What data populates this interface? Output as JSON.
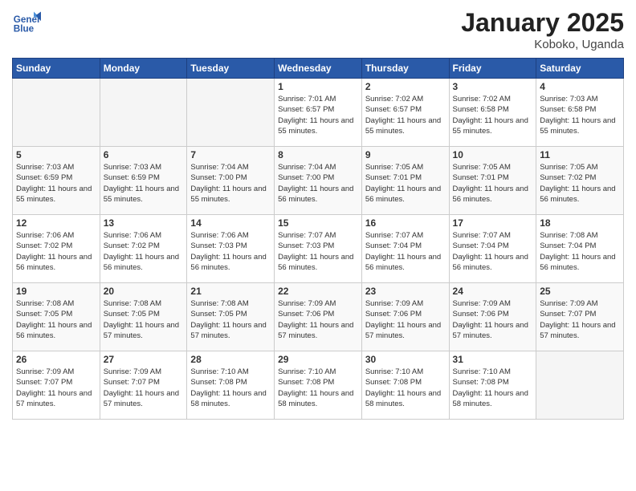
{
  "header": {
    "logo_line1": "General",
    "logo_line2": "Blue",
    "month_title": "January 2025",
    "subtitle": "Koboko, Uganda"
  },
  "days_of_week": [
    "Sunday",
    "Monday",
    "Tuesday",
    "Wednesday",
    "Thursday",
    "Friday",
    "Saturday"
  ],
  "weeks": [
    [
      {
        "day": "",
        "empty": true
      },
      {
        "day": "",
        "empty": true
      },
      {
        "day": "",
        "empty": true
      },
      {
        "day": "1",
        "sunrise": "7:01 AM",
        "sunset": "6:57 PM",
        "daylight": "11 hours and 55 minutes."
      },
      {
        "day": "2",
        "sunrise": "7:02 AM",
        "sunset": "6:57 PM",
        "daylight": "11 hours and 55 minutes."
      },
      {
        "day": "3",
        "sunrise": "7:02 AM",
        "sunset": "6:58 PM",
        "daylight": "11 hours and 55 minutes."
      },
      {
        "day": "4",
        "sunrise": "7:03 AM",
        "sunset": "6:58 PM",
        "daylight": "11 hours and 55 minutes."
      }
    ],
    [
      {
        "day": "5",
        "sunrise": "7:03 AM",
        "sunset": "6:59 PM",
        "daylight": "11 hours and 55 minutes."
      },
      {
        "day": "6",
        "sunrise": "7:03 AM",
        "sunset": "6:59 PM",
        "daylight": "11 hours and 55 minutes."
      },
      {
        "day": "7",
        "sunrise": "7:04 AM",
        "sunset": "7:00 PM",
        "daylight": "11 hours and 55 minutes."
      },
      {
        "day": "8",
        "sunrise": "7:04 AM",
        "sunset": "7:00 PM",
        "daylight": "11 hours and 56 minutes."
      },
      {
        "day": "9",
        "sunrise": "7:05 AM",
        "sunset": "7:01 PM",
        "daylight": "11 hours and 56 minutes."
      },
      {
        "day": "10",
        "sunrise": "7:05 AM",
        "sunset": "7:01 PM",
        "daylight": "11 hours and 56 minutes."
      },
      {
        "day": "11",
        "sunrise": "7:05 AM",
        "sunset": "7:02 PM",
        "daylight": "11 hours and 56 minutes."
      }
    ],
    [
      {
        "day": "12",
        "sunrise": "7:06 AM",
        "sunset": "7:02 PM",
        "daylight": "11 hours and 56 minutes."
      },
      {
        "day": "13",
        "sunrise": "7:06 AM",
        "sunset": "7:02 PM",
        "daylight": "11 hours and 56 minutes."
      },
      {
        "day": "14",
        "sunrise": "7:06 AM",
        "sunset": "7:03 PM",
        "daylight": "11 hours and 56 minutes."
      },
      {
        "day": "15",
        "sunrise": "7:07 AM",
        "sunset": "7:03 PM",
        "daylight": "11 hours and 56 minutes."
      },
      {
        "day": "16",
        "sunrise": "7:07 AM",
        "sunset": "7:04 PM",
        "daylight": "11 hours and 56 minutes."
      },
      {
        "day": "17",
        "sunrise": "7:07 AM",
        "sunset": "7:04 PM",
        "daylight": "11 hours and 56 minutes."
      },
      {
        "day": "18",
        "sunrise": "7:08 AM",
        "sunset": "7:04 PM",
        "daylight": "11 hours and 56 minutes."
      }
    ],
    [
      {
        "day": "19",
        "sunrise": "7:08 AM",
        "sunset": "7:05 PM",
        "daylight": "11 hours and 56 minutes."
      },
      {
        "day": "20",
        "sunrise": "7:08 AM",
        "sunset": "7:05 PM",
        "daylight": "11 hours and 57 minutes."
      },
      {
        "day": "21",
        "sunrise": "7:08 AM",
        "sunset": "7:05 PM",
        "daylight": "11 hours and 57 minutes."
      },
      {
        "day": "22",
        "sunrise": "7:09 AM",
        "sunset": "7:06 PM",
        "daylight": "11 hours and 57 minutes."
      },
      {
        "day": "23",
        "sunrise": "7:09 AM",
        "sunset": "7:06 PM",
        "daylight": "11 hours and 57 minutes."
      },
      {
        "day": "24",
        "sunrise": "7:09 AM",
        "sunset": "7:06 PM",
        "daylight": "11 hours and 57 minutes."
      },
      {
        "day": "25",
        "sunrise": "7:09 AM",
        "sunset": "7:07 PM",
        "daylight": "11 hours and 57 minutes."
      }
    ],
    [
      {
        "day": "26",
        "sunrise": "7:09 AM",
        "sunset": "7:07 PM",
        "daylight": "11 hours and 57 minutes."
      },
      {
        "day": "27",
        "sunrise": "7:09 AM",
        "sunset": "7:07 PM",
        "daylight": "11 hours and 57 minutes."
      },
      {
        "day": "28",
        "sunrise": "7:10 AM",
        "sunset": "7:08 PM",
        "daylight": "11 hours and 58 minutes."
      },
      {
        "day": "29",
        "sunrise": "7:10 AM",
        "sunset": "7:08 PM",
        "daylight": "11 hours and 58 minutes."
      },
      {
        "day": "30",
        "sunrise": "7:10 AM",
        "sunset": "7:08 PM",
        "daylight": "11 hours and 58 minutes."
      },
      {
        "day": "31",
        "sunrise": "7:10 AM",
        "sunset": "7:08 PM",
        "daylight": "11 hours and 58 minutes."
      },
      {
        "day": "",
        "empty": true
      }
    ]
  ]
}
